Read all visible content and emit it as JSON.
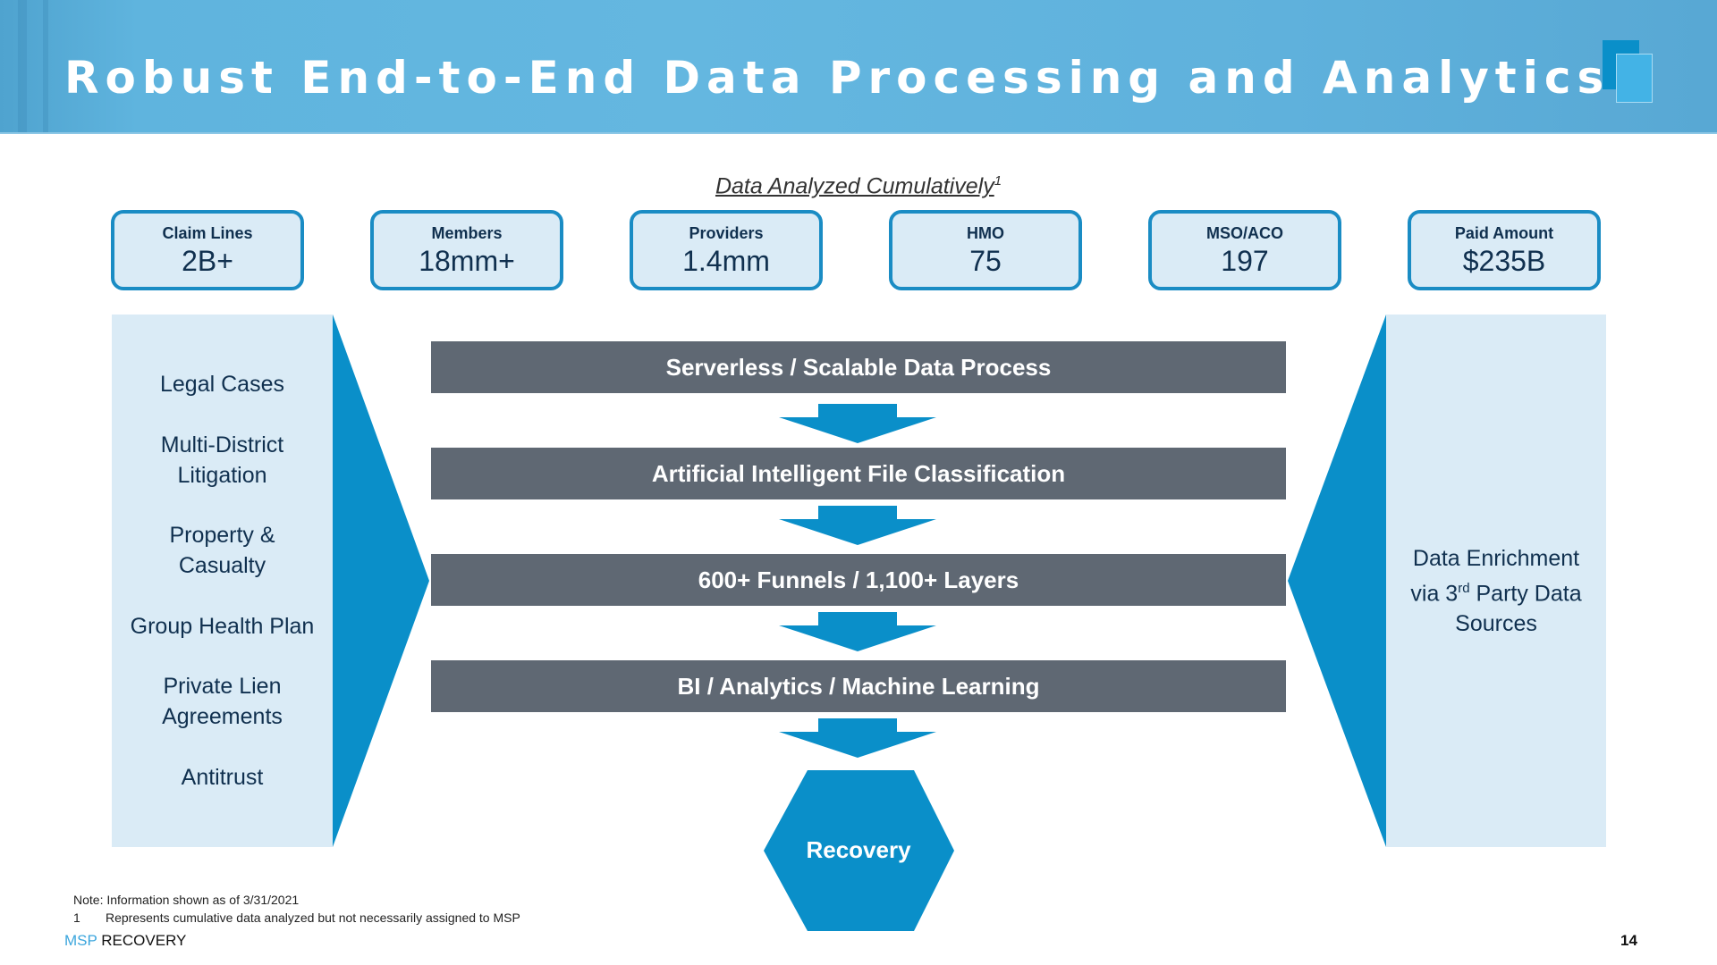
{
  "header": {
    "title": "Robust End-to-End Data Processing and Analytics",
    "logo_icon": "stacked-pages-icon"
  },
  "subtitle": {
    "text": "Data Analyzed Cumulatively",
    "footnote_marker": "1"
  },
  "stats": [
    {
      "label": "Claim Lines",
      "value": "2B+"
    },
    {
      "label": "Members",
      "value": "18mm+"
    },
    {
      "label": "Providers",
      "value": "1.4mm"
    },
    {
      "label": "HMO",
      "value": "75"
    },
    {
      "label": "MSO/ACO",
      "value": "197"
    },
    {
      "label": "Paid Amount",
      "value": "$235B"
    }
  ],
  "left_panel": {
    "items": [
      {
        "line1": "Legal Cases",
        "line2": ""
      },
      {
        "line1": "Multi-District",
        "line2": "Litigation"
      },
      {
        "line1": "Property &",
        "line2": "Casualty"
      },
      {
        "line1": "Group Health Plan",
        "line2": ""
      },
      {
        "line1": "Private Lien",
        "line2": "Agreements"
      },
      {
        "line1": "Antitrust",
        "line2": ""
      }
    ]
  },
  "right_panel": {
    "line1": "Data Enrichment",
    "line2_prefix": "via 3",
    "line2_sup": "rd",
    "line2_suffix": " Party Data",
    "line3": "Sources"
  },
  "process_steps": [
    "Serverless / Scalable Data Process",
    "Artificial Intelligent File Classification",
    "600+ Funnels / 1,100+ Layers",
    "BI / Analytics / Machine Learning"
  ],
  "outcome": "Recovery",
  "footer": {
    "note": "Note: Information shown as of 3/31/2021",
    "footnote_number": "1",
    "footnote_text": "Represents cumulative data analyzed but not necessarily assigned to MSP",
    "brand_accent": "MSP",
    "brand_rest": " RECOVERY",
    "page_number": "14"
  },
  "colors": {
    "accent_blue": "#0a8fc9",
    "stat_border": "#1a8cc4",
    "panel_fill": "#daebf6",
    "bar_gray": "#5f6873",
    "text_navy": "#10304f",
    "brand_light_blue": "#3ca6dd"
  }
}
